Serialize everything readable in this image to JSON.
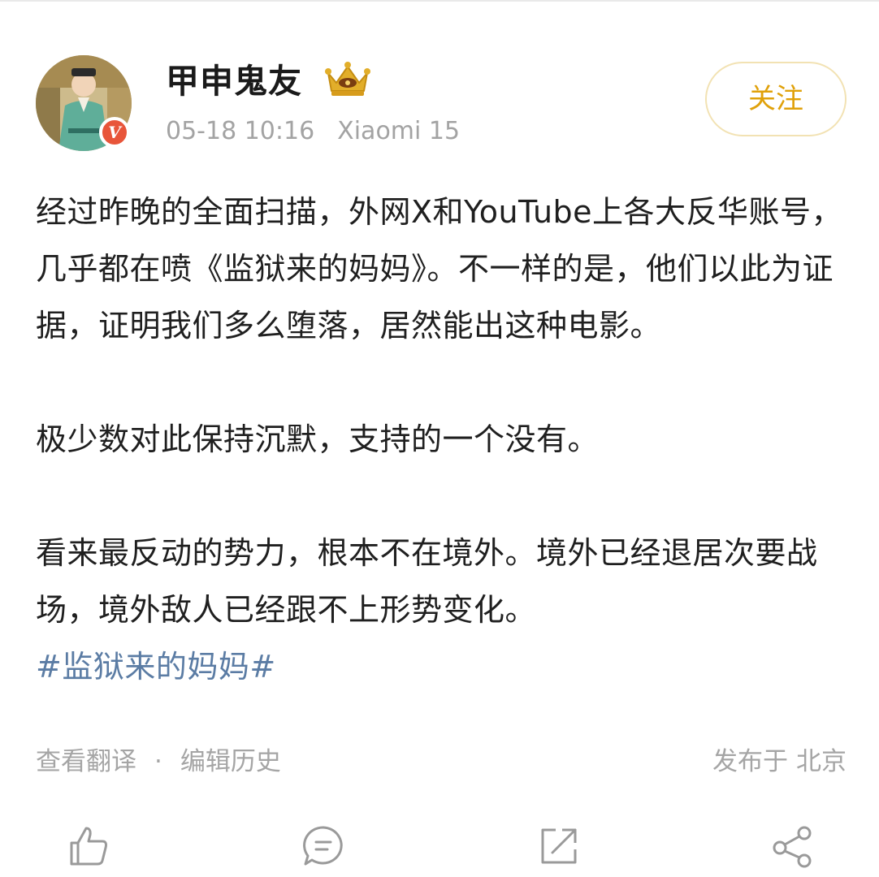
{
  "post": {
    "author": {
      "name": "甲申鬼友",
      "verified_mark": "V",
      "badge_icon": "crown-icon"
    },
    "date_time": "05-18 10:16",
    "device": "Xiaomi 15",
    "follow_label": "关注",
    "paragraphs": [
      "经过昨晚的全面扫描，外网X和YouTube上各大反华账号，几乎都在喷《监狱来的妈妈》。不一样的是，他们以此为证据，证明我们多么堕落，居然能出这种电影。",
      "极少数对此保持沉默，支持的一个没有。",
      "看来最反动的势力，根本不在境外。境外已经退居次要战场，境外敌人已经跟不上形势变化。"
    ],
    "hashtag": "#监狱来的妈妈#",
    "translate_label": "查看翻译",
    "separator": "·",
    "edit_history_label": "编辑历史",
    "published_prefix": "发布于",
    "location": "北京"
  },
  "actions": [
    {
      "icon": "thumbs-up-icon"
    },
    {
      "icon": "comment-icon"
    },
    {
      "icon": "repost-icon"
    },
    {
      "icon": "share-icon"
    }
  ],
  "colors": {
    "follow_text": "#e0a10a",
    "follow_border": "#f2e2b3",
    "hashtag": "#5b7ca4",
    "meta_text": "#a3a3a3",
    "verified_badge": "#e8553a"
  }
}
